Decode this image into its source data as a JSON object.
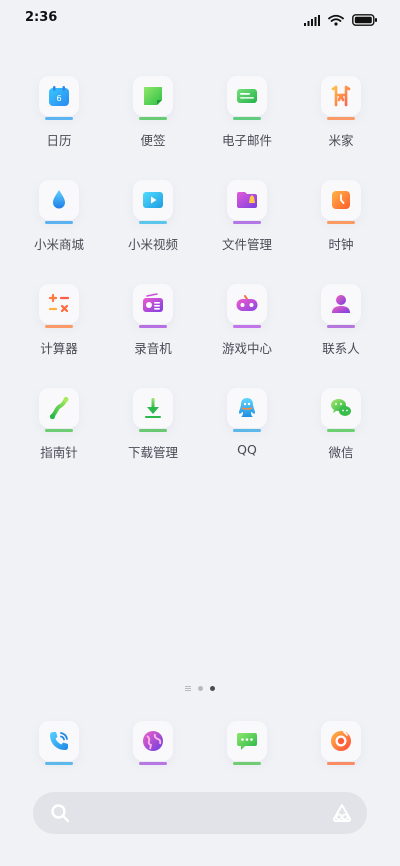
{
  "status_bar": {
    "time": "2:36",
    "icons": [
      "signal-icon",
      "wifi-icon",
      "battery-icon"
    ]
  },
  "apps": [
    {
      "label": "日历",
      "icon": "calendar-icon",
      "accent": "#2ea0f2",
      "icon_text": "6"
    },
    {
      "label": "便签",
      "icon": "notes-icon",
      "accent": "#3ec24a"
    },
    {
      "label": "电子邮件",
      "icon": "email-icon",
      "accent": "#33c25a"
    },
    {
      "label": "米家",
      "icon": "mijia-icon",
      "accent": "#ff7f3a"
    },
    {
      "label": "小米商城",
      "icon": "mi-store-icon",
      "accent": "#2c9ef0"
    },
    {
      "label": "小米视频",
      "icon": "mi-video-icon",
      "accent": "#29b8e8"
    },
    {
      "label": "文件管理",
      "icon": "file-manager-icon",
      "accent": "#a04de0"
    },
    {
      "label": "时钟",
      "icon": "clock-icon",
      "accent": "#ff7d2f"
    },
    {
      "label": "计算器",
      "icon": "calculator-icon",
      "accent": "#ff7f3a"
    },
    {
      "label": "录音机",
      "icon": "recorder-icon",
      "accent": "#a547dd"
    },
    {
      "label": "游戏中心",
      "icon": "game-center-icon",
      "accent": "#b44ce8"
    },
    {
      "label": "联系人",
      "icon": "contacts-icon",
      "accent": "#a34fd6"
    },
    {
      "label": "指南针",
      "icon": "compass-icon",
      "accent": "#43c24a"
    },
    {
      "label": "下载管理",
      "icon": "download-manager-icon",
      "accent": "#3dbb47"
    },
    {
      "label": "QQ",
      "icon": "qq-icon",
      "accent": "#2ba6e6"
    },
    {
      "label": "微信",
      "icon": "wechat-icon",
      "accent": "#41c748"
    }
  ],
  "page_dots": {
    "count": 3,
    "active_index": 2
  },
  "dock": [
    {
      "icon": "phone-icon",
      "accent": "#2ea6e8"
    },
    {
      "icon": "browser-icon",
      "accent": "#a44fdd"
    },
    {
      "icon": "messages-icon",
      "accent": "#46c24a"
    },
    {
      "icon": "camera-icon",
      "accent": "#ff6b35"
    }
  ],
  "search_bar": {
    "icon": "search-icon",
    "right_icon": "assistant-icon"
  }
}
